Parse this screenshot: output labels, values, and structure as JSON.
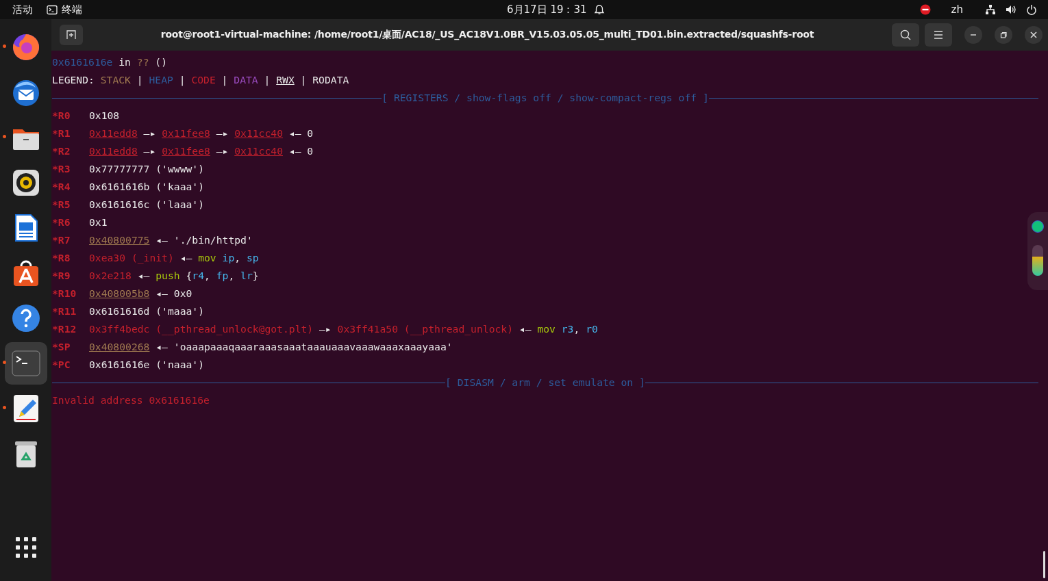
{
  "topbar": {
    "activities": "活动",
    "app_name": "终端",
    "clock": "6月17日  19：31",
    "language": "zh"
  },
  "dock": {
    "items": [
      {
        "kind": "browser",
        "running": true,
        "selected": false
      },
      {
        "kind": "mail",
        "running": false,
        "selected": false
      },
      {
        "kind": "files",
        "running": true,
        "selected": false
      },
      {
        "kind": "music",
        "running": false,
        "selected": false
      },
      {
        "kind": "document",
        "running": false,
        "selected": false
      },
      {
        "kind": "store",
        "running": false,
        "selected": false
      },
      {
        "kind": "help",
        "running": false,
        "selected": false
      },
      {
        "kind": "terminal",
        "running": true,
        "selected": true
      },
      {
        "kind": "editor",
        "running": true,
        "selected": false
      },
      {
        "kind": "trash",
        "running": false,
        "selected": false
      }
    ]
  },
  "window": {
    "title": "root@root1-virtual-machine: /home/root1/桌面/AC18/_US_AC18V1.0BR_V15.03.05.05_multi_TD01.bin.extracted/squashfs-root"
  },
  "terminal": {
    "lines": [
      {
        "kind": "text",
        "segments": [
          {
            "color": "#2d5c9c",
            "underlined": false,
            "t": "0x6161616e"
          },
          {
            "underlined": false,
            "t": " in "
          },
          {
            "color": "#a07a50",
            "underlined": false,
            "t": "??"
          },
          {
            "underlined": false,
            "t": " ()"
          }
        ]
      },
      {
        "kind": "text",
        "segments": [
          {
            "underlined": false,
            "t": "LEGEND: "
          },
          {
            "color": "#a07a50",
            "underlined": false,
            "t": "STACK"
          },
          {
            "underlined": false,
            "t": " | "
          },
          {
            "color": "#2d5c9c",
            "underlined": false,
            "t": "HEAP"
          },
          {
            "underlined": false,
            "t": " | "
          },
          {
            "color": "#c4202c",
            "underlined": false,
            "t": "CODE"
          },
          {
            "underlined": false,
            "t": " | "
          },
          {
            "color": "#9b4cc0",
            "underlined": false,
            "t": "DATA"
          },
          {
            "underlined": false,
            "t": " | "
          },
          {
            "underlined": true,
            "t": "RWX"
          },
          {
            "underlined": false,
            "t": " | RODATA"
          }
        ]
      },
      {
        "kind": "rule",
        "title": "[ REGISTERS / show-flags off / show-compact-regs off ]"
      },
      {
        "kind": "register",
        "name": "*R0",
        "segments": [
          {
            "underlined": false,
            "t": "0x108"
          }
        ]
      },
      {
        "kind": "register",
        "name": "*R1",
        "segments": [
          {
            "color": "#c4202c",
            "underlined": true,
            "t": "0x11edd8"
          },
          {
            "underlined": false,
            "t": " —▸ "
          },
          {
            "color": "#c4202c",
            "underlined": true,
            "t": "0x11fee8"
          },
          {
            "underlined": false,
            "t": " —▸ "
          },
          {
            "color": "#c4202c",
            "underlined": true,
            "t": "0x11cc40"
          },
          {
            "underlined": false,
            "t": " ◂— 0"
          }
        ]
      },
      {
        "kind": "register",
        "name": "*R2",
        "segments": [
          {
            "color": "#c4202c",
            "underlined": true,
            "t": "0x11edd8"
          },
          {
            "underlined": false,
            "t": " —▸ "
          },
          {
            "color": "#c4202c",
            "underlined": true,
            "t": "0x11fee8"
          },
          {
            "underlined": false,
            "t": " —▸ "
          },
          {
            "color": "#c4202c",
            "underlined": true,
            "t": "0x11cc40"
          },
          {
            "underlined": false,
            "t": " ◂— 0"
          }
        ]
      },
      {
        "kind": "register",
        "name": "*R3",
        "segments": [
          {
            "underlined": false,
            "t": "0x77777777 ('wwww')"
          }
        ]
      },
      {
        "kind": "register",
        "name": "*R4",
        "segments": [
          {
            "underlined": false,
            "t": "0x6161616b ('kaaa')"
          }
        ]
      },
      {
        "kind": "register",
        "name": "*R5",
        "segments": [
          {
            "underlined": false,
            "t": "0x6161616c ('laaa')"
          }
        ]
      },
      {
        "kind": "register",
        "name": "*R6",
        "segments": [
          {
            "underlined": false,
            "t": "0x1"
          }
        ]
      },
      {
        "kind": "register",
        "name": "*R7",
        "segments": [
          {
            "color": "#a07a50",
            "underlined": true,
            "t": "0x40800775"
          },
          {
            "underlined": false,
            "t": " ◂— './bin/httpd'"
          }
        ]
      },
      {
        "kind": "register",
        "name": "*R8",
        "segments": [
          {
            "color": "#c4202c",
            "underlined": false,
            "t": "0xea30 (_init)"
          },
          {
            "underlined": false,
            "t": " ◂— "
          },
          {
            "color": "#a8c80c",
            "underlined": false,
            "t": "mov "
          },
          {
            "color": "#45b6ec",
            "underlined": false,
            "t": "ip"
          },
          {
            "underlined": false,
            "t": ", "
          },
          {
            "color": "#45b6ec",
            "underlined": false,
            "t": "sp"
          }
        ]
      },
      {
        "kind": "register",
        "name": "*R9",
        "segments": [
          {
            "color": "#c4202c",
            "underlined": false,
            "t": "0x2e218"
          },
          {
            "underlined": false,
            "t": " ◂— "
          },
          {
            "color": "#a8c80c",
            "underlined": false,
            "t": "push"
          },
          {
            "underlined": false,
            "t": " {"
          },
          {
            "color": "#45b6ec",
            "underlined": false,
            "t": "r4"
          },
          {
            "underlined": false,
            "t": ", "
          },
          {
            "color": "#45b6ec",
            "underlined": false,
            "t": "fp"
          },
          {
            "underlined": false,
            "t": ", "
          },
          {
            "color": "#45b6ec",
            "underlined": false,
            "t": "lr"
          },
          {
            "underlined": false,
            "t": "}"
          }
        ]
      },
      {
        "kind": "register",
        "name": "*R10",
        "segments": [
          {
            "color": "#a07a50",
            "underlined": true,
            "t": "0x408005b8"
          },
          {
            "underlined": false,
            "t": " ◂— 0x0"
          }
        ]
      },
      {
        "kind": "register",
        "name": "*R11",
        "segments": [
          {
            "underlined": false,
            "t": "0x6161616d ('maaa')"
          }
        ]
      },
      {
        "kind": "register",
        "name": "*R12",
        "segments": [
          {
            "color": "#c4202c",
            "underlined": false,
            "t": "0x3ff4bedc (__pthread_unlock@got.plt)"
          },
          {
            "underlined": false,
            "t": " —▸ "
          },
          {
            "color": "#c4202c",
            "underlined": false,
            "t": "0x3ff41a50 (__pthread_unlock)"
          },
          {
            "underlined": false,
            "t": " ◂— "
          },
          {
            "color": "#a8c80c",
            "underlined": false,
            "t": "mov "
          },
          {
            "color": "#45b6ec",
            "underlined": false,
            "t": "r3"
          },
          {
            "underlined": false,
            "t": ", "
          },
          {
            "color": "#45b6ec",
            "underlined": false,
            "t": "r0"
          }
        ]
      },
      {
        "kind": "register",
        "name": "*SP",
        "segments": [
          {
            "color": "#a07a50",
            "underlined": true,
            "t": "0x40800268"
          },
          {
            "underlined": false,
            "t": " ◂— 'oaaapaaaqaaaraaasaaataaauaaavaaawaaaxaaayaaa'"
          }
        ]
      },
      {
        "kind": "register",
        "name": "*PC",
        "segments": [
          {
            "underlined": false,
            "t": "0x6161616e ('naaa')"
          }
        ]
      },
      {
        "kind": "rule",
        "title": "[ DISASM / arm / set emulate on ]"
      },
      {
        "kind": "text",
        "segments": [
          {
            "color": "#c4202c",
            "underlined": false,
            "t": "Invalid address 0x6161616e"
          }
        ]
      }
    ]
  },
  "side_widget": {
    "level": 0.62
  }
}
